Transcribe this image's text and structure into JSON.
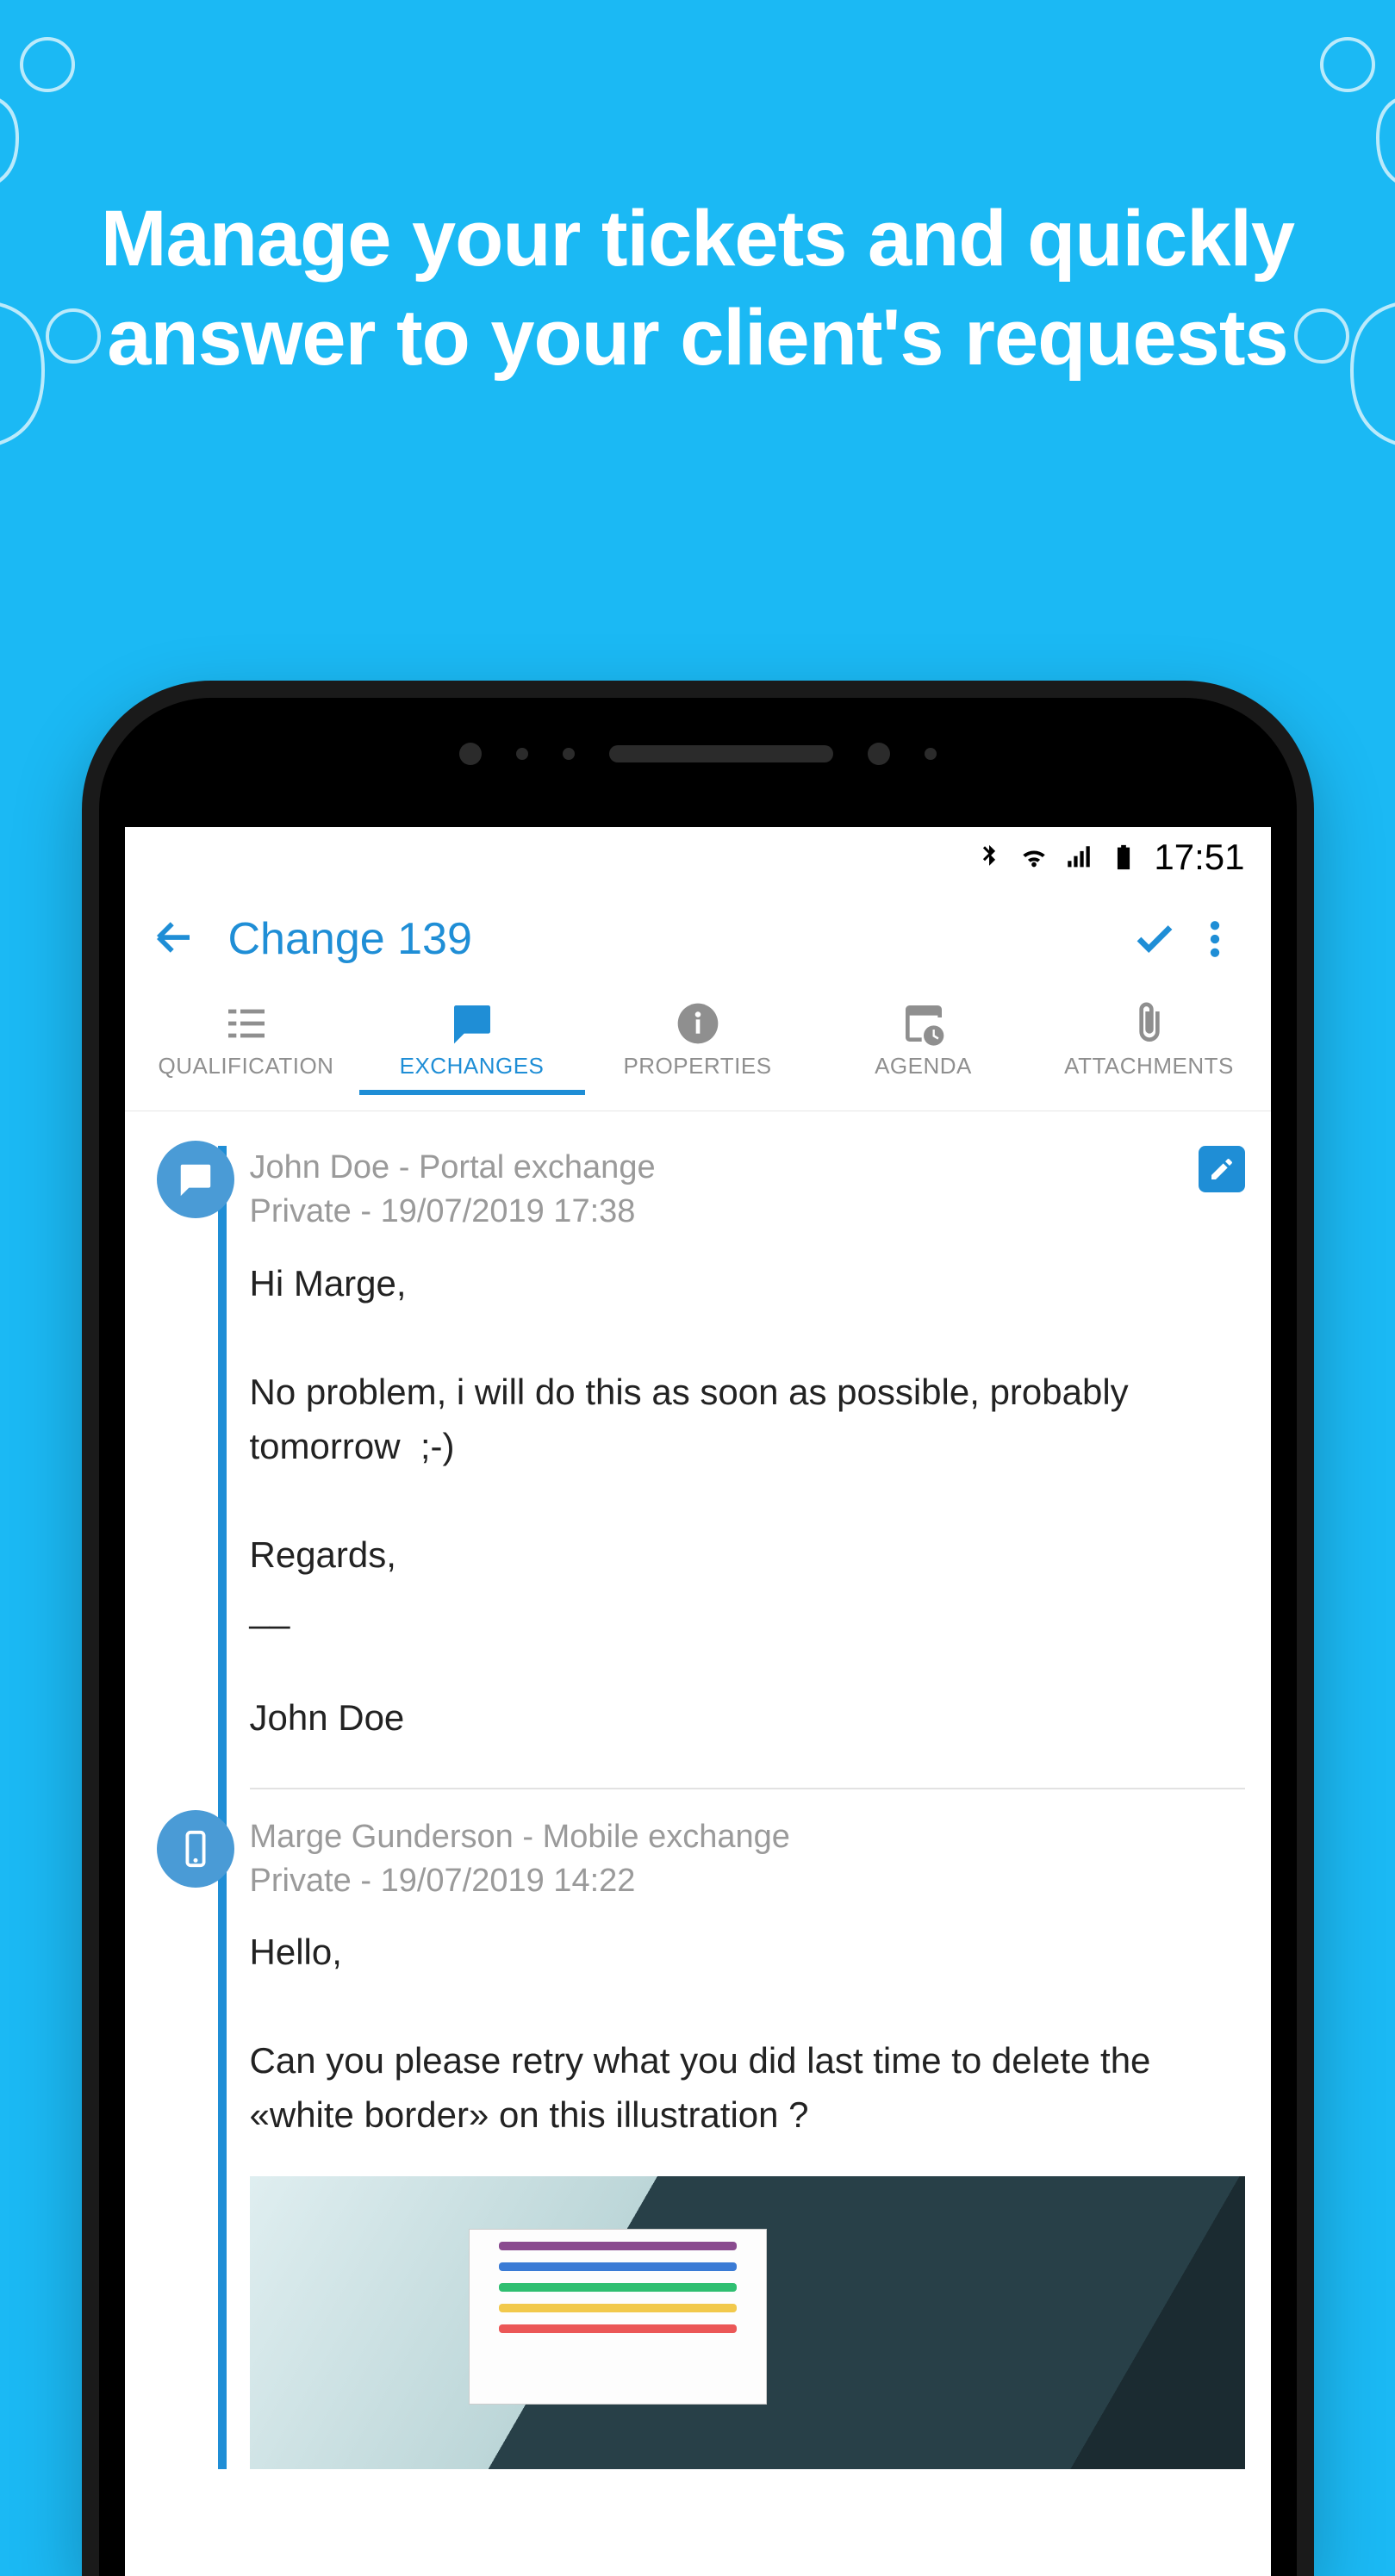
{
  "marketing": {
    "headline": "Manage your tickets and quickly answer to your client's requests"
  },
  "status": {
    "time": "17:51"
  },
  "appbar": {
    "title": "Change 139"
  },
  "tabs": [
    {
      "label": "QUALIFICATION",
      "active": false
    },
    {
      "label": "EXCHANGES",
      "active": true
    },
    {
      "label": "PROPERTIES",
      "active": false
    },
    {
      "label": "AGENDA",
      "active": false
    },
    {
      "label": "ATTACHMENTS",
      "active": false
    }
  ],
  "exchanges": [
    {
      "icon": "chat",
      "author": "John Doe",
      "channel": "Portal exchange",
      "visibility": "Private",
      "timestamp": "19/07/2019 17:38",
      "editable": true,
      "body": "Hi Marge,\n\nNo problem, i will do this as soon as possible, probably tomorrow  ;-)\n\nRegards,\n__\n\nJohn Doe"
    },
    {
      "icon": "mobile",
      "author": "Marge Gunderson",
      "channel": "Mobile exchange",
      "visibility": "Private",
      "timestamp": "19/07/2019 14:22",
      "editable": false,
      "body": "Hello,\n\nCan you please retry what you did last time to delete the «white border» on this illustration ?",
      "has_attachment": true
    }
  ]
}
